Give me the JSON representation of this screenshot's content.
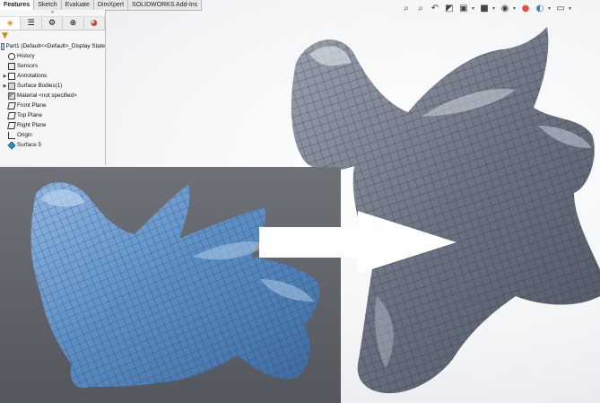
{
  "command_tabs": [
    "Features",
    "Sketch",
    "Evaluate",
    "DimXpert",
    "SOLIDWORKS Add-Ins"
  ],
  "active_tab": "Features",
  "featuremanager": {
    "collapse_glyph": "»",
    "tab_icons": [
      "feature-tree-icon",
      "property-manager-icon",
      "configuration-manager-icon",
      "dimxpert-manager-icon",
      "display-manager-icon"
    ],
    "filter_icon": "filter-icon",
    "tree": [
      {
        "label": "Part1  (Default<<Default>_Display State",
        "icon": "part-icon",
        "expandable": false,
        "level": 0
      },
      {
        "label": "History",
        "icon": "history-icon",
        "expandable": false,
        "level": 1
      },
      {
        "label": "Sensors",
        "icon": "sensors-icon",
        "expandable": false,
        "level": 1
      },
      {
        "label": "Annotations",
        "icon": "annotations-icon",
        "expandable": true,
        "level": 1
      },
      {
        "label": "Surface Bodies(1)",
        "icon": "surface-bodies-icon",
        "expandable": true,
        "level": 1
      },
      {
        "label": "Material <not specified>",
        "icon": "material-icon",
        "expandable": false,
        "level": 1
      },
      {
        "label": "Front Plane",
        "icon": "plane-icon",
        "expandable": false,
        "level": 1
      },
      {
        "label": "Top Plane",
        "icon": "plane-icon",
        "expandable": false,
        "level": 1
      },
      {
        "label": "Right Plane",
        "icon": "plane-icon",
        "expandable": false,
        "level": 1
      },
      {
        "label": "Origin",
        "icon": "origin-icon",
        "expandable": false,
        "level": 1
      },
      {
        "label": "Surface 5",
        "icon": "surface-feature-icon",
        "expandable": false,
        "level": 1
      }
    ]
  },
  "heads_up_toolbar": [
    "zoom-to-fit-icon",
    "zoom-to-area-icon",
    "previous-view-icon",
    "section-view-icon",
    "view-orientation-icon",
    "display-style-icon",
    "hide-show-items-icon",
    "edit-appearance-icon",
    "apply-scene-icon",
    "view-settings-icon"
  ],
  "colors": {
    "mesh_blue": "#5d8fc6",
    "mesh_grey": "#6b7281",
    "inset_background": "#606368",
    "arrow": "#ffffff"
  }
}
